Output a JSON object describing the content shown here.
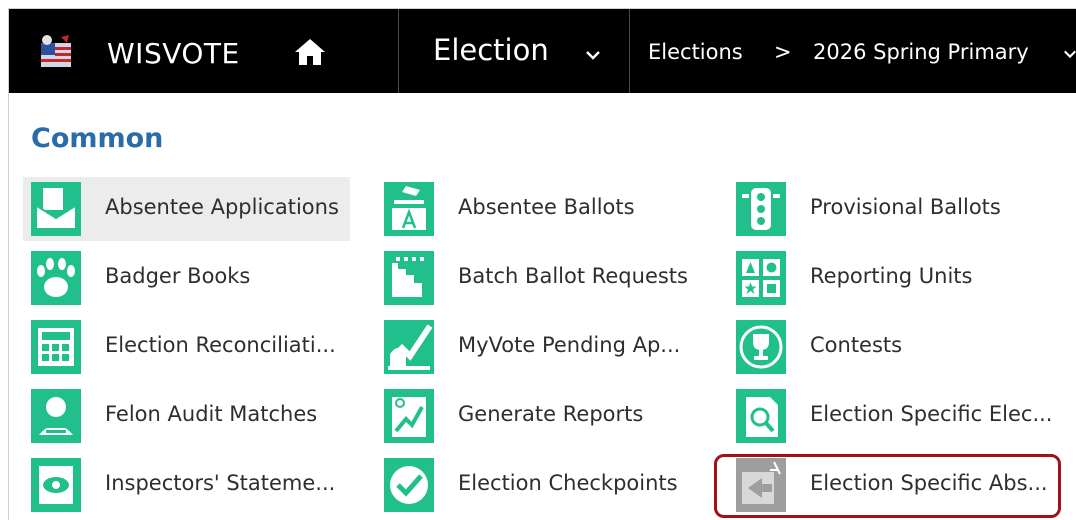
{
  "header": {
    "app_name": "WISVOTE",
    "area": "Election",
    "breadcrumb": [
      "Elections",
      ">",
      "2026 Spring Primary"
    ]
  },
  "group": {
    "title": "Common"
  },
  "tiles": [
    {
      "label": "Absentee Applications",
      "icon": "absentee-applications-icon"
    },
    {
      "label": "Absentee Ballots",
      "icon": "absentee-ballots-icon"
    },
    {
      "label": "Provisional Ballots",
      "icon": "provisional-ballots-icon"
    },
    {
      "label": "Badger Books",
      "icon": "badger-paw-icon"
    },
    {
      "label": "Batch Ballot Requests",
      "icon": "batch-ballot-icon"
    },
    {
      "label": "Reporting Units",
      "icon": "reporting-units-icon"
    },
    {
      "label": "Election Reconciliati...",
      "icon": "calculator-icon"
    },
    {
      "label": "MyVote Pending Ap...",
      "icon": "capitol-check-icon"
    },
    {
      "label": "Contests",
      "icon": "trophy-icon"
    },
    {
      "label": "Felon Audit Matches",
      "icon": "felon-icon"
    },
    {
      "label": "Generate Reports",
      "icon": "reports-icon"
    },
    {
      "label": "Election Specific Elec...",
      "icon": "document-search-icon"
    },
    {
      "label": "Inspectors' Stateme...",
      "icon": "eye-document-icon"
    },
    {
      "label": "Election Checkpoints",
      "icon": "checkmark-icon"
    },
    {
      "label": "Election Specific Abs...",
      "icon": "absentee-specific-icon"
    }
  ],
  "colors": {
    "tile_icon": "#21bf8c",
    "tile_icon_disabled": "#9e9e9e",
    "group_title": "#2b6ba8",
    "highlight_border": "#a40f1f"
  }
}
